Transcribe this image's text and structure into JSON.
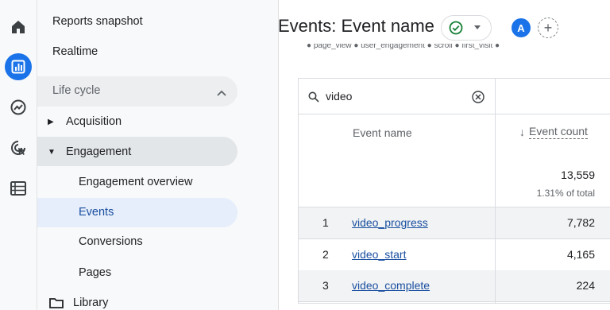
{
  "nav": {
    "reports_snapshot": "Reports snapshot",
    "realtime": "Realtime",
    "lifecycle": "Life cycle",
    "acquisition": "Acquisition",
    "engagement": "Engagement",
    "engagement_overview": "Engagement overview",
    "events": "Events",
    "conversions": "Conversions",
    "pages": "Pages",
    "library": "Library"
  },
  "header": {
    "title": "Events: Event name",
    "avatar_initial": "A"
  },
  "legend_strip": "● page_view   ● user_engagement   ● scroll   ● first_visit   ●",
  "table": {
    "search": {
      "value": "video"
    },
    "col_name": "Event name",
    "col_count": "Event count",
    "sort_arrow": "↓",
    "total_value": "13,559",
    "total_pct": "1.31% of total",
    "rows": [
      {
        "idx": "1",
        "event": "video_progress",
        "count": "7,782"
      },
      {
        "idx": "2",
        "event": "video_start",
        "count": "4,165"
      },
      {
        "idx": "3",
        "event": "video_complete",
        "count": "224"
      }
    ]
  },
  "colors": {
    "accent": "#1a73e8",
    "link": "#1a4fa0",
    "status_ok": "#188038"
  }
}
